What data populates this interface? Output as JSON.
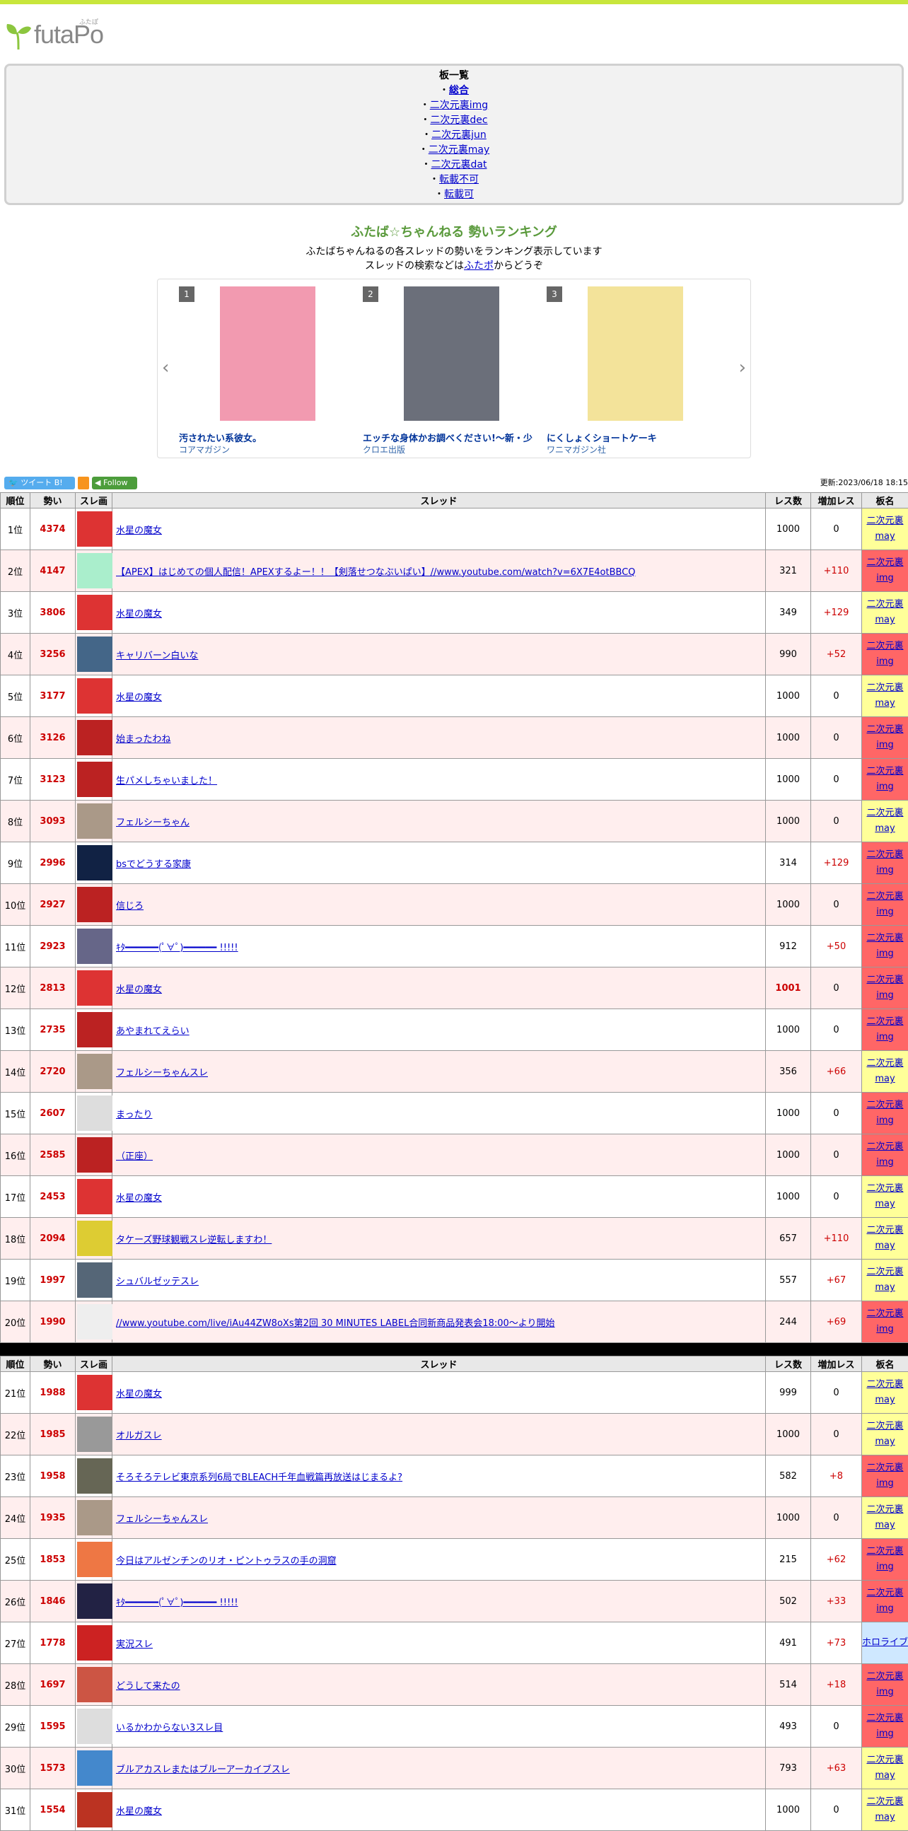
{
  "logo": {
    "text": "futaPo",
    "ruby": "ふたぽ"
  },
  "boards": {
    "title": "板一覧",
    "items": [
      "総合",
      "二次元裏img",
      "二次元裏dec",
      "二次元裏jun",
      "二次元裏may",
      "二次元裏dat",
      "転載不可",
      "転載可"
    ]
  },
  "ranking": {
    "title": "ふたば☆ちゃんねる 勢いランキング",
    "desc1": "ふたばちゃんねるの各スレッドの勢いをランキング表示しています",
    "desc2_pre": "スレッドの検索などは",
    "desc2_link": "ふたポ",
    "desc2_post": "からどうぞ"
  },
  "carousel": [
    {
      "num": "1",
      "title": "汚されたい系彼女。",
      "publisher": "コアマガジン",
      "color": "#f29ab0"
    },
    {
      "num": "2",
      "title": "エッチな身体かお調べください!～新・少",
      "publisher": "クロエ出版",
      "color": "#6b6f7a"
    },
    {
      "num": "3",
      "title": "にくしょくショートケーキ",
      "publisher": "ワニマガジン社",
      "color": "#f3e39a"
    }
  ],
  "social": {
    "tweet": "ツイート",
    "follow": "Follow",
    "updated": "更新:2023/06/18 18:15"
  },
  "table": {
    "headers": [
      "順位",
      "勢い",
      "スレ画",
      "スレッド",
      "レス数",
      "増加レス",
      "板名"
    ],
    "rows1": [
      {
        "rank": "1位",
        "momentum": "4374",
        "title": "水星の魔女",
        "res": "1000",
        "inc": "0",
        "board": "二次元裏may",
        "bt": "may",
        "c": "#d33"
      },
      {
        "rank": "2位",
        "momentum": "4147",
        "title": "【APEX】はじめての個人配信！APEXするよー！！【剣落せつなぶいぱい】//www.youtube.com/watch?v=6X7E4otBBCQ",
        "res": "321",
        "inc": "+110",
        "board": "二次元裏img",
        "bt": "img",
        "c": "#aec"
      },
      {
        "rank": "3位",
        "momentum": "3806",
        "title": "水星の魔女",
        "res": "349",
        "inc": "+129",
        "board": "二次元裏may",
        "bt": "may",
        "c": "#d33"
      },
      {
        "rank": "4位",
        "momentum": "3256",
        "title": "キャリバーン白いな",
        "res": "990",
        "inc": "+52",
        "board": "二次元裏img",
        "bt": "img",
        "c": "#468"
      },
      {
        "rank": "5位",
        "momentum": "3177",
        "title": "水星の魔女",
        "res": "1000",
        "inc": "0",
        "board": "二次元裏may",
        "bt": "may",
        "c": "#d33"
      },
      {
        "rank": "6位",
        "momentum": "3126",
        "title": "始まったわね",
        "res": "1000",
        "inc": "0",
        "board": "二次元裏img",
        "bt": "img",
        "c": "#b22"
      },
      {
        "rank": "7位",
        "momentum": "3123",
        "title": "生パメしちゃいました！",
        "res": "1000",
        "inc": "0",
        "board": "二次元裏img",
        "bt": "img",
        "c": "#b22"
      },
      {
        "rank": "8位",
        "momentum": "3093",
        "title": "フェルシーちゃん",
        "res": "1000",
        "inc": "0",
        "board": "二次元裏may",
        "bt": "may",
        "c": "#a98"
      },
      {
        "rank": "9位",
        "momentum": "2996",
        "title": "bsでどうする家康",
        "res": "314",
        "inc": "+129",
        "board": "二次元裏img",
        "bt": "img",
        "c": "#124"
      },
      {
        "rank": "10位",
        "momentum": "2927",
        "title": "信じろ",
        "res": "1000",
        "inc": "0",
        "board": "二次元裏img",
        "bt": "img",
        "c": "#b22"
      },
      {
        "rank": "11位",
        "momentum": "2923",
        "title": "ｷﾀ━━━━━━(ﾟ∀ﾟ)━━━━━━ !!!!!",
        "res": "912",
        "inc": "+50",
        "board": "二次元裏img",
        "bt": "img",
        "c": "#668"
      },
      {
        "rank": "12位",
        "momentum": "2813",
        "title": "水星の魔女",
        "res": "1001",
        "inc": "0",
        "board": "二次元裏img",
        "bt": "img",
        "c": "#d33"
      },
      {
        "rank": "13位",
        "momentum": "2735",
        "title": "あやまれてえらい",
        "res": "1000",
        "inc": "0",
        "board": "二次元裏img",
        "bt": "img",
        "c": "#b22"
      },
      {
        "rank": "14位",
        "momentum": "2720",
        "title": "フェルシーちゃんスレ",
        "res": "356",
        "inc": "+66",
        "board": "二次元裏may",
        "bt": "may",
        "c": "#a98"
      },
      {
        "rank": "15位",
        "momentum": "2607",
        "title": "まったり",
        "res": "1000",
        "inc": "0",
        "board": "二次元裏img",
        "bt": "img",
        "c": "#ddd"
      },
      {
        "rank": "16位",
        "momentum": "2585",
        "title": "（正座）",
        "res": "1000",
        "inc": "0",
        "board": "二次元裏img",
        "bt": "img",
        "c": "#b22"
      },
      {
        "rank": "17位",
        "momentum": "2453",
        "title": "水星の魔女",
        "res": "1000",
        "inc": "0",
        "board": "二次元裏may",
        "bt": "may",
        "c": "#d33"
      },
      {
        "rank": "18位",
        "momentum": "2094",
        "title": "タケーズ野球観戦スレ逆転しますわ！",
        "res": "657",
        "inc": "+110",
        "board": "二次元裏may",
        "bt": "may",
        "c": "#dc3"
      },
      {
        "rank": "19位",
        "momentum": "1997",
        "title": "シュバルゼッテスレ",
        "res": "557",
        "inc": "+67",
        "board": "二次元裏may",
        "bt": "may",
        "c": "#567"
      },
      {
        "rank": "20位",
        "momentum": "1990",
        "title": "//www.youtube.com/live/iAu44ZW8oXs第2回 30 MINUTES LABEL合同新商品発表会18:00～より開始",
        "res": "244",
        "inc": "+69",
        "board": "二次元裏img",
        "bt": "img",
        "c": "#eee"
      }
    ],
    "rows2": [
      {
        "rank": "21位",
        "momentum": "1988",
        "title": "水星の魔女",
        "res": "999",
        "inc": "0",
        "board": "二次元裏may",
        "bt": "may",
        "c": "#d33"
      },
      {
        "rank": "22位",
        "momentum": "1985",
        "title": "オルガスレ",
        "res": "1000",
        "inc": "0",
        "board": "二次元裏may",
        "bt": "may",
        "c": "#999"
      },
      {
        "rank": "23位",
        "momentum": "1958",
        "title": "そろそろテレビ東京系列6局でBLEACH千年血戦篇再放送はじまるよ?",
        "res": "582",
        "inc": "+8",
        "board": "二次元裏img",
        "bt": "img",
        "c": "#665"
      },
      {
        "rank": "24位",
        "momentum": "1935",
        "title": "フェルシーちゃんスレ",
        "res": "1000",
        "inc": "0",
        "board": "二次元裏may",
        "bt": "may",
        "c": "#a98"
      },
      {
        "rank": "25位",
        "momentum": "1853",
        "title": "今日はアルゼンチンのリオ・ピントゥラスの手の洞窟",
        "res": "215",
        "inc": "+62",
        "board": "二次元裏img",
        "bt": "img",
        "c": "#e74"
      },
      {
        "rank": "26位",
        "momentum": "1846",
        "title": "ｷﾀ━━━━━━(ﾟ∀ﾟ)━━━━━━ !!!!!",
        "res": "502",
        "inc": "+33",
        "board": "二次元裏img",
        "bt": "img",
        "c": "#224"
      },
      {
        "rank": "27位",
        "momentum": "1778",
        "title": "実況スレ",
        "res": "491",
        "inc": "+73",
        "board": "ホロライブ",
        "bt": "holo",
        "c": "#c22"
      },
      {
        "rank": "28位",
        "momentum": "1697",
        "title": "どうして来たの",
        "res": "514",
        "inc": "+18",
        "board": "二次元裏img",
        "bt": "img",
        "c": "#c54"
      },
      {
        "rank": "29位",
        "momentum": "1595",
        "title": "いるかわからない3スレ目",
        "res": "493",
        "inc": "0",
        "board": "二次元裏img",
        "bt": "img",
        "c": "#ddd"
      },
      {
        "rank": "30位",
        "momentum": "1573",
        "title": "ブルアカスレまたはブルーアーカイブスレ",
        "res": "793",
        "inc": "+63",
        "board": "二次元裏may",
        "bt": "may",
        "c": "#48c"
      },
      {
        "rank": "31位",
        "momentum": "1554",
        "title": "水星の魔女",
        "res": "1000",
        "inc": "0",
        "board": "二次元裏may",
        "bt": "may",
        "c": "#b32"
      }
    ]
  }
}
